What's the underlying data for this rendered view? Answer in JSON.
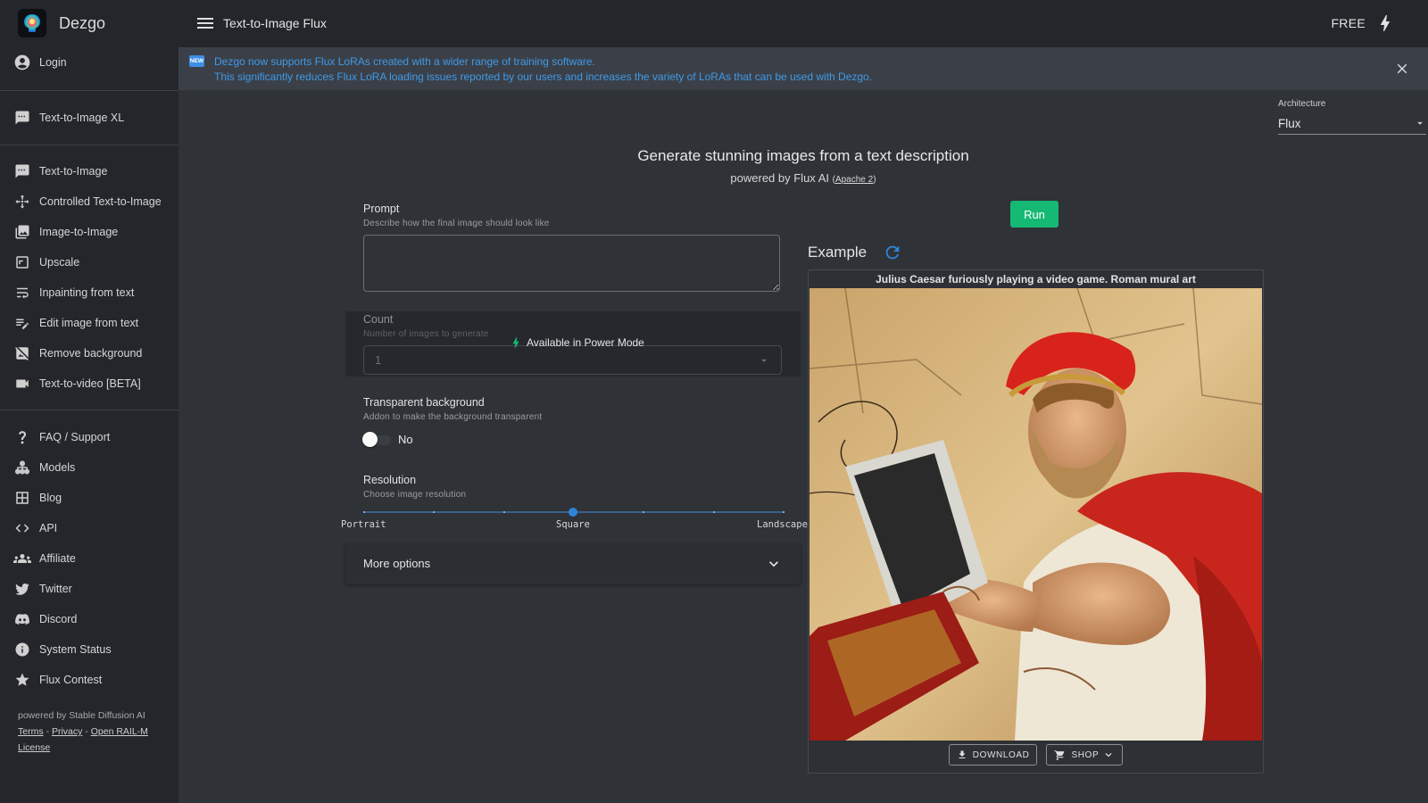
{
  "app": {
    "name": "Dezgo"
  },
  "sidebar": {
    "login": "Login",
    "group1": [
      "Text-to-Image XL"
    ],
    "group2": [
      "Text-to-Image",
      "Controlled Text-to-Image",
      "Image-to-Image",
      "Upscale",
      "Inpainting from text",
      "Edit image from text",
      "Remove background",
      "Text-to-video [BETA]"
    ],
    "group3": [
      "FAQ / Support",
      "Models",
      "Blog",
      "API",
      "Affiliate",
      "Twitter",
      "Discord",
      "System Status",
      "Flux Contest"
    ],
    "footer": {
      "powered": "powered by Stable Diffusion AI",
      "terms": "Terms",
      "privacy": "Privacy",
      "license": "Open RAIL-M License",
      "sep": " - "
    }
  },
  "topbar": {
    "title": "Text-to-Image Flux",
    "plan": "FREE"
  },
  "banner": {
    "badge": "NEW",
    "line1": "Dezgo now supports Flux LoRAs created with a wider range of training software.",
    "line2": "This significantly reduces Flux LoRA loading issues reported by our users and increases the variety of LoRAs that can be used with Dezgo."
  },
  "architecture": {
    "label": "Architecture",
    "value": "Flux"
  },
  "hero": {
    "title": "Generate stunning images from a text description",
    "powered": "powered by Flux AI",
    "license_open": "(",
    "license": "Apache 2",
    "license_close": ")"
  },
  "form": {
    "prompt_label": "Prompt",
    "prompt_hint": "Describe how the final image should look like",
    "prompt_value": "",
    "count_label": "Count",
    "count_hint": "Number of images to generate",
    "count_value": "1",
    "power_mode": "Available in Power Mode",
    "transparent_label": "Transparent background",
    "transparent_hint": "Addon to make the background transparent",
    "transparent_value": "No",
    "resolution_label": "Resolution",
    "resolution_hint": "Choose image resolution",
    "resolution_options": [
      "Portrait",
      "Square",
      "Landscape"
    ],
    "resolution_selected": 0.5,
    "more_options": "More options"
  },
  "run": {
    "label": "Run"
  },
  "example": {
    "title": "Example",
    "caption": "Julius Caesar furiously playing a video game. Roman mural art",
    "download": "DOWNLOAD",
    "shop": "SHOP"
  },
  "colors": {
    "accent_green": "#16b974",
    "link_blue": "#3f9ae8",
    "sidebar_bg": "#24262b",
    "page_bg": "#2f3237"
  }
}
